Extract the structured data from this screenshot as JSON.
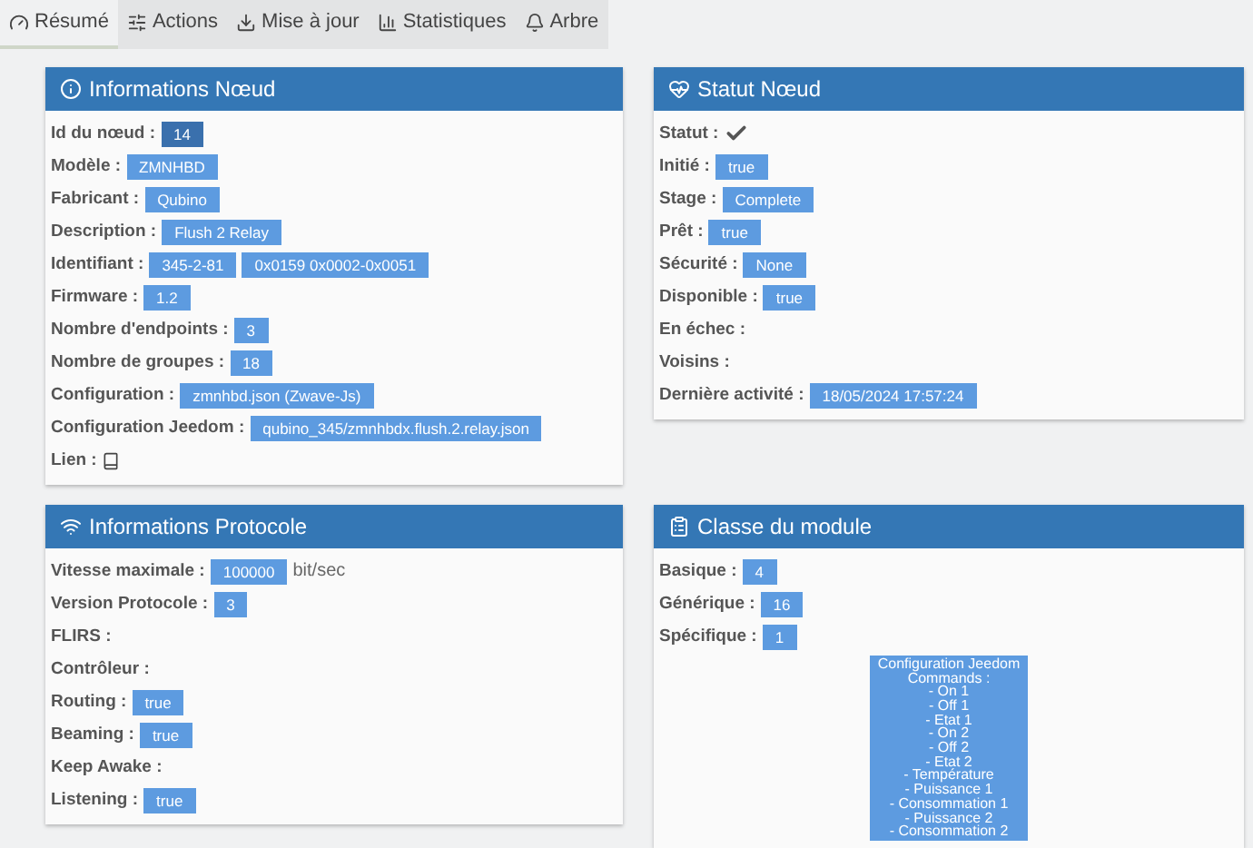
{
  "tabs": [
    {
      "label": "Résumé",
      "selected": true
    },
    {
      "label": "Actions",
      "selected": false
    },
    {
      "label": "Mise à jour",
      "selected": false
    },
    {
      "label": "Statistiques",
      "selected": false
    },
    {
      "label": "Arbre",
      "selected": false
    }
  ],
  "panels": [
    {
      "title": "Informations Nœud",
      "rows": [
        {
          "label": "Id du nœud :",
          "kind": "badge-dark",
          "values": [
            "14"
          ]
        },
        {
          "label": "Modèle :",
          "kind": "badge",
          "values": [
            "ZMNHBD"
          ]
        },
        {
          "label": "Fabricant :",
          "kind": "badge",
          "values": [
            "Qubino"
          ]
        },
        {
          "label": "Description :",
          "kind": "badge",
          "values": [
            "Flush 2 Relay"
          ]
        },
        {
          "label": "Identifiant :",
          "kind": "badge",
          "values": [
            "345-2-81",
            "0x0159 0x0002-0x0051"
          ]
        },
        {
          "label": "Firmware :",
          "kind": "badge",
          "values": [
            "1.2"
          ]
        },
        {
          "label": "Nombre d'endpoints :",
          "kind": "badge",
          "values": [
            "3"
          ]
        },
        {
          "label": "Nombre de groupes :",
          "kind": "badge",
          "values": [
            "18"
          ]
        },
        {
          "label": "Configuration :",
          "kind": "badge",
          "values": [
            "zmnhbd.json (Zwave-Js)"
          ]
        },
        {
          "label": "Configuration Jeedom :",
          "kind": "badge",
          "values": [
            "qubino_345/zmnhbdx.flush.2.relay.json"
          ]
        },
        {
          "label": "Lien :",
          "kind": "book-icon"
        }
      ]
    },
    {
      "title": "Statut Nœud",
      "rows": [
        {
          "label": "Statut :",
          "kind": "check-icon"
        },
        {
          "label": "Initié :",
          "kind": "badge",
          "values": [
            "true"
          ]
        },
        {
          "label": "Stage :",
          "kind": "badge",
          "values": [
            "Complete"
          ]
        },
        {
          "label": "Prêt :",
          "kind": "badge",
          "values": [
            "true"
          ]
        },
        {
          "label": "Sécurité :",
          "kind": "badge",
          "values": [
            "None"
          ]
        },
        {
          "label": "Disponible :",
          "kind": "badge",
          "values": [
            "true"
          ]
        },
        {
          "label": "En échec :",
          "kind": "empty"
        },
        {
          "label": "Voisins :",
          "kind": "empty"
        },
        {
          "label": "Dernière activité :",
          "kind": "badge",
          "values": [
            "18/05/2024 17:57:24"
          ]
        }
      ]
    },
    {
      "title": "Informations Protocole",
      "rows": [
        {
          "label": "Vitesse maximale :",
          "kind": "badge",
          "values": [
            "100000"
          ],
          "unit": "bit/sec"
        },
        {
          "label": "Version Protocole :",
          "kind": "badge",
          "values": [
            "3"
          ]
        },
        {
          "label": "FLIRS :",
          "kind": "empty"
        },
        {
          "label": "Contrôleur :",
          "kind": "empty"
        },
        {
          "label": "Routing :",
          "kind": "badge",
          "values": [
            "true"
          ]
        },
        {
          "label": "Beaming :",
          "kind": "badge",
          "values": [
            "true"
          ]
        },
        {
          "label": "Keep Awake :",
          "kind": "empty"
        },
        {
          "label": "Listening :",
          "kind": "badge",
          "values": [
            "true"
          ]
        }
      ]
    },
    {
      "title": "Classe du module",
      "rows": [
        {
          "label": "Basique :",
          "kind": "badge",
          "values": [
            "4"
          ]
        },
        {
          "label": "Générique :",
          "kind": "badge",
          "values": [
            "16"
          ]
        },
        {
          "label": "Spécifique :",
          "kind": "badge",
          "values": [
            "1"
          ]
        }
      ],
      "note": [
        "Configuration Jeedom",
        "Commands :",
        "- On 1",
        "- Off 1",
        "- Etat 1",
        "- On 2",
        "- Off 2",
        "- Etat 2",
        "- Température",
        "- Puissance 1",
        "- Consommation 1",
        "- Puissance 2",
        "- Consommation 2"
      ]
    }
  ]
}
